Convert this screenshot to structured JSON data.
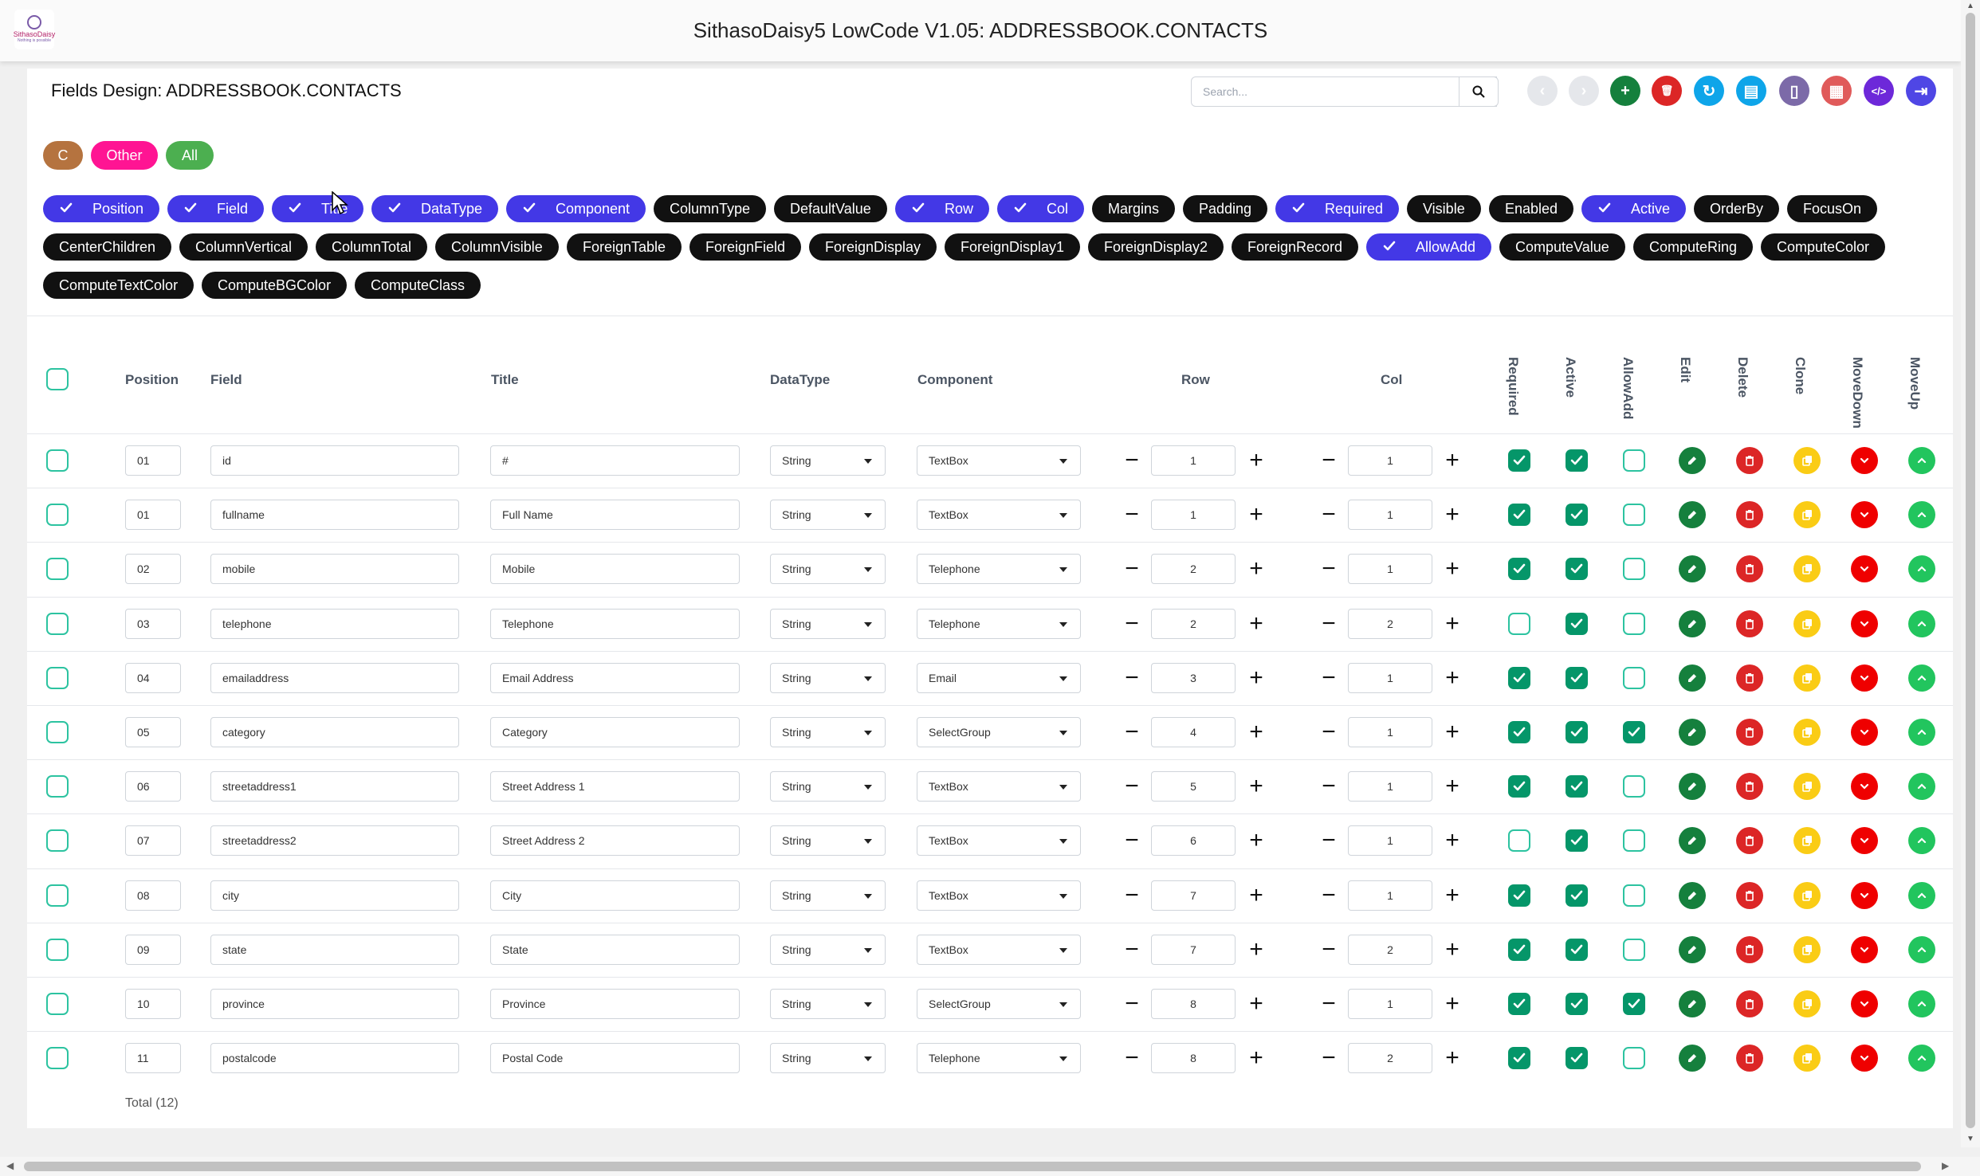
{
  "app": {
    "title": "SithasoDaisy5 LowCode V1.05: ADDRESSBOOK.CONTACTS",
    "logo_text": "SithasoDaisy",
    "logo_sub": "Nothing is possible"
  },
  "page": {
    "title": "Fields Design: ADDRESSBOOK.CONTACTS"
  },
  "search": {
    "placeholder": "Search..."
  },
  "toolbar": [
    {
      "name": "back-icon",
      "color": "#e5e7eb",
      "glyph": "‹"
    },
    {
      "name": "forward-icon",
      "color": "#e5e7eb",
      "glyph": "›"
    },
    {
      "name": "add-icon",
      "color": "#15803d",
      "glyph": "+"
    },
    {
      "name": "delete-all-icon",
      "color": "#dc2626",
      "glyph": "🗑"
    },
    {
      "name": "refresh-icon",
      "color": "#0ea5e9",
      "glyph": "↻"
    },
    {
      "name": "database-icon",
      "color": "#0ea5e9",
      "glyph": "▤"
    },
    {
      "name": "mobile-icon",
      "color": "#7c6aa8",
      "glyph": "▯"
    },
    {
      "name": "grid-icon",
      "color": "#e05a5a",
      "glyph": "▦"
    },
    {
      "name": "code-icon",
      "color": "#6d28d9",
      "glyph": "</>"
    },
    {
      "name": "logout-icon",
      "color": "#4f46e5",
      "glyph": "⇥"
    }
  ],
  "groups": [
    {
      "label": "C",
      "color": "#b5733f"
    },
    {
      "label": "Other",
      "color": "#ff1493"
    },
    {
      "label": "All",
      "color": "#4caf50"
    }
  ],
  "filters": [
    {
      "label": "Position",
      "on": true
    },
    {
      "label": "Field",
      "on": true
    },
    {
      "label": "Title",
      "on": true
    },
    {
      "label": "DataType",
      "on": true
    },
    {
      "label": "Component",
      "on": true
    },
    {
      "label": "ColumnType",
      "on": false
    },
    {
      "label": "DefaultValue",
      "on": false
    },
    {
      "label": "Row",
      "on": true
    },
    {
      "label": "Col",
      "on": true
    },
    {
      "label": "Margins",
      "on": false
    },
    {
      "label": "Padding",
      "on": false
    },
    {
      "label": "Required",
      "on": true
    },
    {
      "label": "Visible",
      "on": false
    },
    {
      "label": "Enabled",
      "on": false
    },
    {
      "label": "Active",
      "on": true
    },
    {
      "label": "OrderBy",
      "on": false
    },
    {
      "label": "FocusOn",
      "on": false
    },
    {
      "label": "CenterChildren",
      "on": false
    },
    {
      "label": "ColumnVertical",
      "on": false
    },
    {
      "label": "ColumnTotal",
      "on": false
    },
    {
      "label": "ColumnVisible",
      "on": false
    },
    {
      "label": "ForeignTable",
      "on": false
    },
    {
      "label": "ForeignField",
      "on": false
    },
    {
      "label": "ForeignDisplay",
      "on": false
    },
    {
      "label": "ForeignDisplay1",
      "on": false
    },
    {
      "label": "ForeignDisplay2",
      "on": false
    },
    {
      "label": "ForeignRecord",
      "on": false
    },
    {
      "label": "AllowAdd",
      "on": true
    },
    {
      "label": "ComputeValue",
      "on": false
    },
    {
      "label": "ComputeRing",
      "on": false
    },
    {
      "label": "ComputeColor",
      "on": false
    },
    {
      "label": "ComputeTextColor",
      "on": false
    },
    {
      "label": "ComputeBGColor",
      "on": false
    },
    {
      "label": "ComputeClass",
      "on": false
    }
  ],
  "table": {
    "headers": {
      "position": "Position",
      "field": "Field",
      "title": "Title",
      "datatype": "DataType",
      "component": "Component",
      "row": "Row",
      "col": "Col"
    },
    "vheaders": [
      "Required",
      "Active",
      "AllowAdd",
      "Edit",
      "Delete",
      "Clone",
      "MoveDown",
      "MoveUp"
    ],
    "rows": [
      {
        "position": "01",
        "field": "id",
        "title": "#",
        "datatype": "String",
        "component": "TextBox",
        "row": "1",
        "col": "1",
        "required": true,
        "active": true,
        "allowadd": false
      },
      {
        "position": "01",
        "field": "fullname",
        "title": "Full Name",
        "datatype": "String",
        "component": "TextBox",
        "row": "1",
        "col": "1",
        "required": true,
        "active": true,
        "allowadd": false
      },
      {
        "position": "02",
        "field": "mobile",
        "title": "Mobile",
        "datatype": "String",
        "component": "Telephone",
        "row": "2",
        "col": "1",
        "required": true,
        "active": true,
        "allowadd": false
      },
      {
        "position": "03",
        "field": "telephone",
        "title": "Telephone",
        "datatype": "String",
        "component": "Telephone",
        "row": "2",
        "col": "2",
        "required": false,
        "active": true,
        "allowadd": false
      },
      {
        "position": "04",
        "field": "emailaddress",
        "title": "Email Address",
        "datatype": "String",
        "component": "Email",
        "row": "3",
        "col": "1",
        "required": true,
        "active": true,
        "allowadd": false
      },
      {
        "position": "05",
        "field": "category",
        "title": "Category",
        "datatype": "String",
        "component": "SelectGroup",
        "row": "4",
        "col": "1",
        "required": true,
        "active": true,
        "allowadd": true
      },
      {
        "position": "06",
        "field": "streetaddress1",
        "title": "Street Address 1",
        "datatype": "String",
        "component": "TextBox",
        "row": "5",
        "col": "1",
        "required": true,
        "active": true,
        "allowadd": false
      },
      {
        "position": "07",
        "field": "streetaddress2",
        "title": "Street Address 2",
        "datatype": "String",
        "component": "TextBox",
        "row": "6",
        "col": "1",
        "required": false,
        "active": true,
        "allowadd": false
      },
      {
        "position": "08",
        "field": "city",
        "title": "City",
        "datatype": "String",
        "component": "TextBox",
        "row": "7",
        "col": "1",
        "required": true,
        "active": true,
        "allowadd": false
      },
      {
        "position": "09",
        "field": "state",
        "title": "State",
        "datatype": "String",
        "component": "TextBox",
        "row": "7",
        "col": "2",
        "required": true,
        "active": true,
        "allowadd": false
      },
      {
        "position": "10",
        "field": "province",
        "title": "Province",
        "datatype": "String",
        "component": "SelectGroup",
        "row": "8",
        "col": "1",
        "required": true,
        "active": true,
        "allowadd": true
      },
      {
        "position": "11",
        "field": "postalcode",
        "title": "Postal Code",
        "datatype": "String",
        "component": "Telephone",
        "row": "8",
        "col": "2",
        "required": true,
        "active": true,
        "allowadd": false
      }
    ],
    "total": "Total (12)"
  },
  "colors": {
    "chip_on": "#4338e6",
    "chip_off": "#111111",
    "check": "#059669",
    "checkbox_border": "#2cc3a0",
    "edit": "#15803d",
    "delete": "#dc2626",
    "clone": "#facc15",
    "movedown": "#ef0000",
    "moveup": "#22c55e"
  }
}
